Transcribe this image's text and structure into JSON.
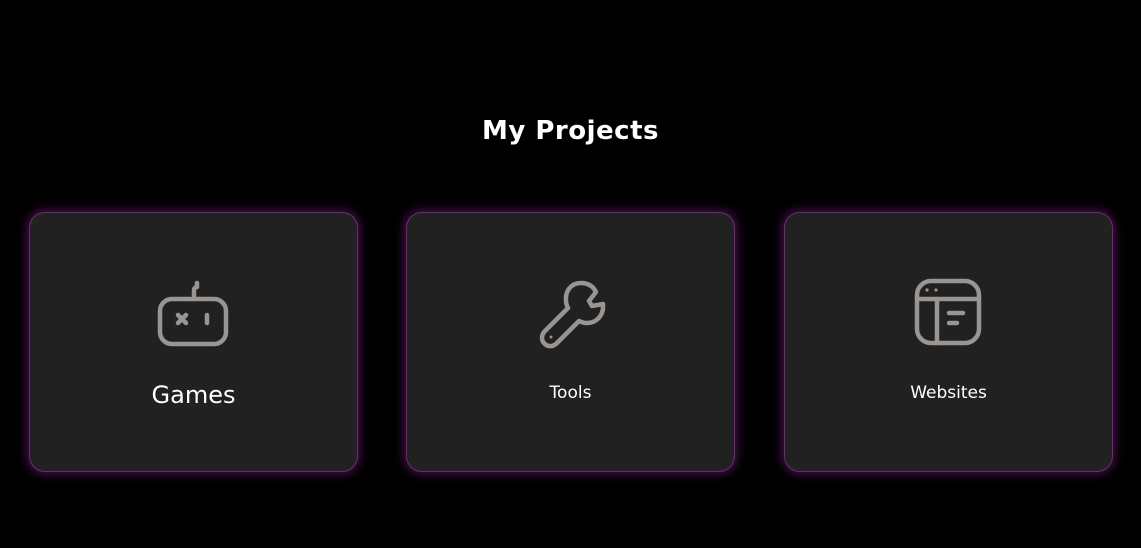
{
  "page": {
    "title": "My Projects"
  },
  "cards": [
    {
      "label": "Games",
      "icon": "robot-game-icon"
    },
    {
      "label": "Tools",
      "icon": "wrench-icon"
    },
    {
      "label": "Websites",
      "icon": "browser-layout-icon"
    }
  ],
  "colors": {
    "background": "#000000",
    "card_background": "#212121",
    "card_glow": "#a028aa",
    "icon": "#9b9591",
    "text": "#ffffff"
  }
}
